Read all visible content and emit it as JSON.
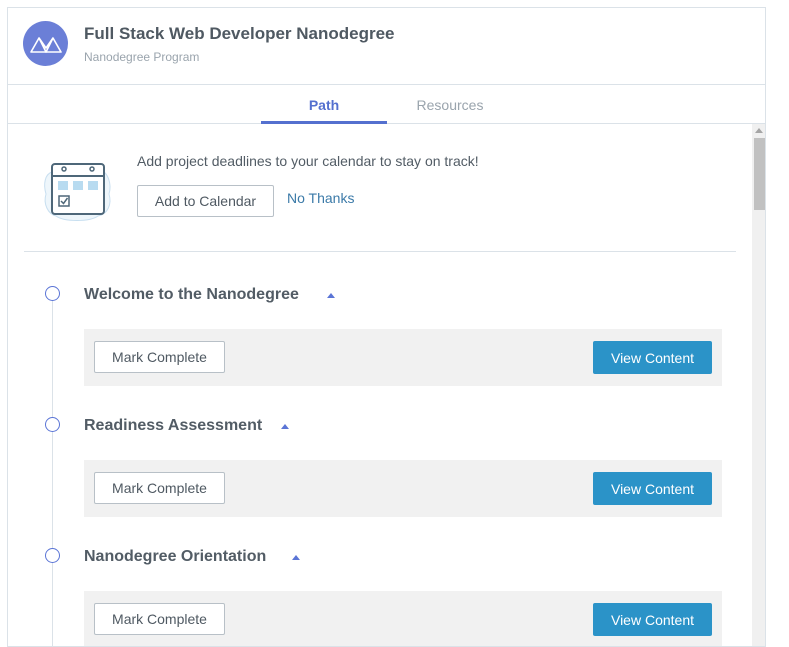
{
  "header": {
    "title": "Full Stack Web Developer Nanodegree",
    "subtitle": "Nanodegree Program",
    "logo_icon": "mountain-icon",
    "logo_color": "#6b7fd7"
  },
  "tabs": [
    {
      "label": "Path",
      "active": true
    },
    {
      "label": "Resources",
      "active": false
    }
  ],
  "calendar_prompt": {
    "icon": "calendar-icon",
    "message": "Add project deadlines to your calendar to stay on track!",
    "add_label": "Add to Calendar",
    "dismiss_label": "No Thanks"
  },
  "lessons": [
    {
      "title": "Welcome to the Nanodegree",
      "mark_label": "Mark Complete",
      "view_label": "View Content",
      "expanded": true
    },
    {
      "title": "Readiness Assessment",
      "mark_label": "Mark Complete",
      "view_label": "View Content",
      "expanded": true
    },
    {
      "title": "Nanodegree Orientation",
      "mark_label": "Mark Complete",
      "view_label": "View Content",
      "expanded": true
    }
  ],
  "colors": {
    "accent": "#5470cf",
    "view_button": "#2b93c8",
    "link": "#3b7aa8"
  }
}
